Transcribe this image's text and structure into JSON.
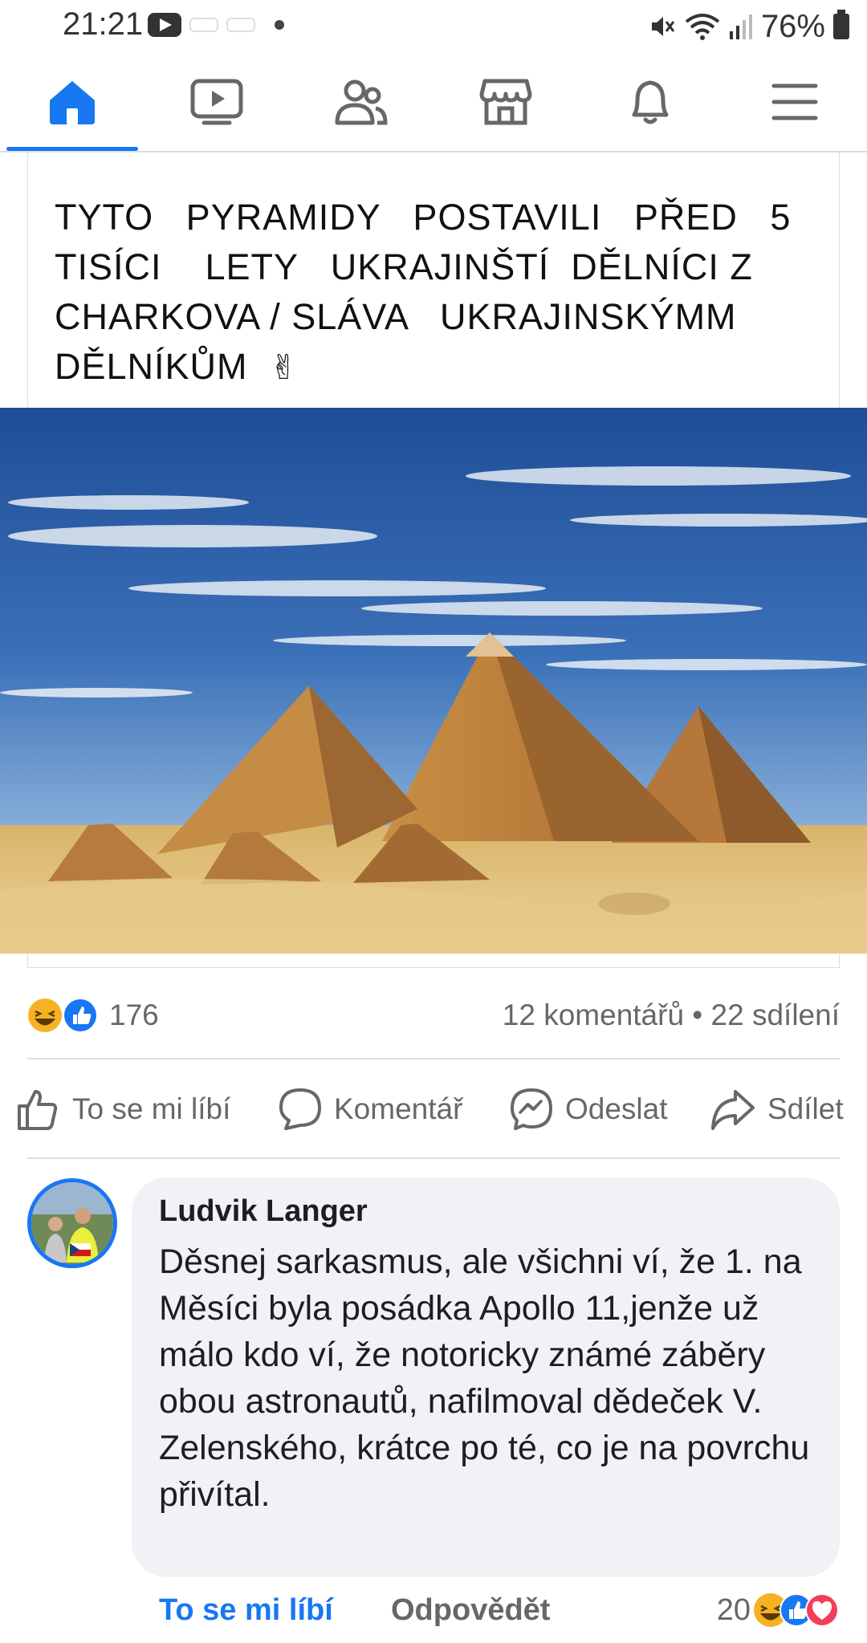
{
  "status_bar": {
    "time": "21:21",
    "battery": "76%",
    "icons": [
      "youtube-icon",
      "mute-icon",
      "wifi-icon",
      "signal-icon",
      "battery-icon"
    ]
  },
  "nav": {
    "tabs": [
      {
        "name": "home",
        "icon": "home-icon",
        "active": true
      },
      {
        "name": "watch",
        "icon": "video-icon",
        "active": false
      },
      {
        "name": "friends",
        "icon": "friends-icon",
        "active": false
      },
      {
        "name": "marketplace",
        "icon": "store-icon",
        "active": false
      },
      {
        "name": "notifications",
        "icon": "bell-icon",
        "active": false
      },
      {
        "name": "menu",
        "icon": "hamburger-icon",
        "active": false
      }
    ],
    "accent_color": "#1877f2"
  },
  "post": {
    "text": "TYTO   PYRAMIDY   POSTAVILI   PŘED   5\nTISÍCI    LETY   UKRAJINŠTÍ  DĚLNÍCI Z\nCHARKOVA / SLÁVA   UKRAJINSKÝMM\nDĚLNÍKŮM",
    "emoji": "✌",
    "image": "pyramids-of-giza-photo"
  },
  "reactions": {
    "count": "176",
    "types": [
      "haha",
      "like"
    ],
    "comments_shares": "12 komentářů • 22 sdílení"
  },
  "actions": {
    "like": "To se mi líbí",
    "comment": "Komentář",
    "send": "Odeslat",
    "share": "Sdílet"
  },
  "comment": {
    "author": "Ludvik Langer",
    "text": "Děsnej sarkasmus, ale všichni ví, že 1. na Měsíci byla posádka Apollo 11,jenže už málo kdo ví, že notoricky známé záběry obou astronautů, nafilmoval dědeček V. Zelenského, krátce po té, co je na povrchu přivítal.",
    "like_label": "To se mi líbí",
    "reply_label": "Odpovědět",
    "reaction_count": "20",
    "reaction_types": [
      "haha",
      "like",
      "love"
    ]
  }
}
